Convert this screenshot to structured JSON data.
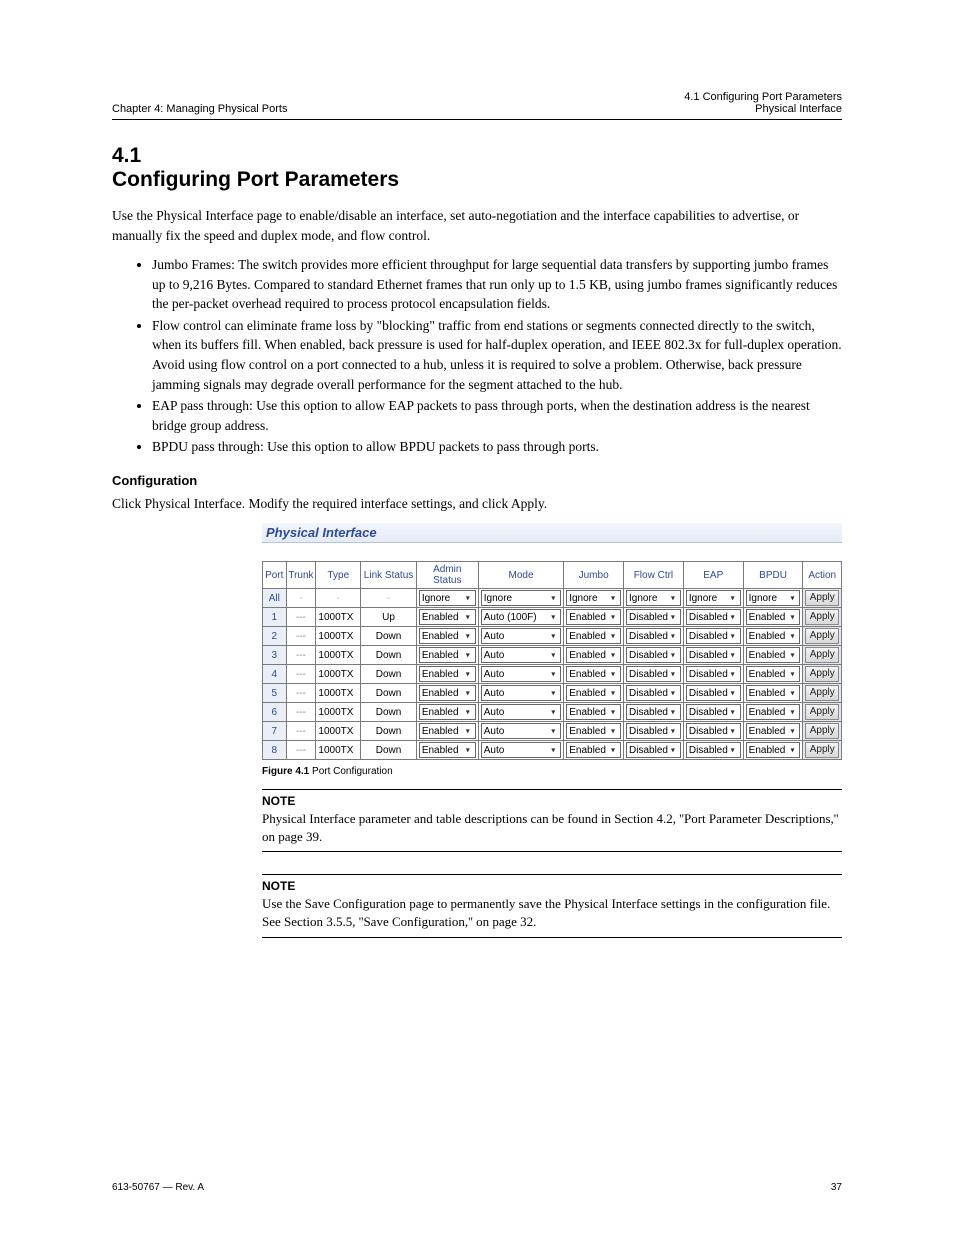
{
  "header": {
    "chapter": "Chapter 4: Managing Physical Ports",
    "right_top": "4.1 Configuring Port Parameters",
    "right_bottom": "Physical Interface"
  },
  "section": {
    "number": "4.1",
    "title": "Configuring Port Parameters",
    "intro": "Use the Physical Interface page to enable/disable an interface, set auto-negotiation and the interface capabilities to advertise, or manually fix the speed and duplex mode, and flow control.",
    "bullets": [
      "Jumbo Frames: The switch provides more efficient throughput for large sequential data transfers by supporting jumbo frames up to 9,216 Bytes. Compared to standard Ethernet frames that run only up to 1.5 KB, using jumbo frames significantly reduces the per-packet overhead required to process protocol encapsulation fields.",
      "Flow control can eliminate frame loss by \"blocking\" traffic from end stations or segments connected directly to the switch, when its buffers fill. When enabled, back pressure is used for half-duplex operation, and IEEE 802.3x for full-duplex operation. Avoid using flow control on a port connected to a hub, unless it is required to solve a problem. Otherwise, back pressure jamming signals may degrade overall performance for the segment attached to the hub.",
      "EAP pass through: Use this option to allow EAP packets to pass through ports, when the destination address is the nearest bridge group address.",
      "BPDU pass through: Use this option to allow BPDU packets to pass through ports."
    ],
    "config_heading": "Configuration",
    "config_steps": "Click Physical Interface. Modify the required interface settings, and click Apply."
  },
  "figure": {
    "panel_title": "Physical Interface",
    "caption_bold": "Figure 4.1",
    "caption_rest": "Port Configuration",
    "columns": [
      "Port",
      "Trunk",
      "Type",
      "Link Status",
      "Admin Status",
      "Mode",
      "Jumbo",
      "Flow Ctrl",
      "EAP",
      "BPDU",
      "Action"
    ],
    "rows": [
      {
        "port": "All",
        "trunk": "-",
        "type": "-",
        "link": "-",
        "admin": "Ignore",
        "mode": "Ignore",
        "jumbo": "Ignore",
        "flow": "Ignore",
        "eap": "Ignore",
        "bpdu": "Ignore",
        "all": true
      },
      {
        "port": "1",
        "trunk": "---",
        "type": "1000TX",
        "link": "Up",
        "admin": "Enabled",
        "mode": "Auto (100F)",
        "jumbo": "Enabled",
        "flow": "Disabled",
        "eap": "Disabled",
        "bpdu": "Enabled"
      },
      {
        "port": "2",
        "trunk": "---",
        "type": "1000TX",
        "link": "Down",
        "admin": "Enabled",
        "mode": "Auto",
        "jumbo": "Enabled",
        "flow": "Disabled",
        "eap": "Disabled",
        "bpdu": "Enabled"
      },
      {
        "port": "3",
        "trunk": "---",
        "type": "1000TX",
        "link": "Down",
        "admin": "Enabled",
        "mode": "Auto",
        "jumbo": "Enabled",
        "flow": "Disabled",
        "eap": "Disabled",
        "bpdu": "Enabled"
      },
      {
        "port": "4",
        "trunk": "---",
        "type": "1000TX",
        "link": "Down",
        "admin": "Enabled",
        "mode": "Auto",
        "jumbo": "Enabled",
        "flow": "Disabled",
        "eap": "Disabled",
        "bpdu": "Enabled"
      },
      {
        "port": "5",
        "trunk": "---",
        "type": "1000TX",
        "link": "Down",
        "admin": "Enabled",
        "mode": "Auto",
        "jumbo": "Enabled",
        "flow": "Disabled",
        "eap": "Disabled",
        "bpdu": "Enabled"
      },
      {
        "port": "6",
        "trunk": "---",
        "type": "1000TX",
        "link": "Down",
        "admin": "Enabled",
        "mode": "Auto",
        "jumbo": "Enabled",
        "flow": "Disabled",
        "eap": "Disabled",
        "bpdu": "Enabled"
      },
      {
        "port": "7",
        "trunk": "---",
        "type": "1000TX",
        "link": "Down",
        "admin": "Enabled",
        "mode": "Auto",
        "jumbo": "Enabled",
        "flow": "Disabled",
        "eap": "Disabled",
        "bpdu": "Enabled"
      },
      {
        "port": "8",
        "trunk": "---",
        "type": "1000TX",
        "link": "Down",
        "admin": "Enabled",
        "mode": "Auto",
        "jumbo": "Enabled",
        "flow": "Disabled",
        "eap": "Disabled",
        "bpdu": "Enabled"
      }
    ],
    "apply_label": "Apply"
  },
  "note1": {
    "label": "NOTE",
    "text": "Physical Interface parameter and table descriptions can be found in Section 4.2, ''Port Parameter Descriptions,'' on page 39."
  },
  "note2": {
    "label": "NOTE",
    "text": "Use the Save Configuration page to permanently save the Physical Interface settings in the configuration file. See Section 3.5.5, ''Save Configuration,'' on page 32."
  },
  "footer": {
    "left": "613-50767 — Rev. A",
    "right": "37"
  }
}
